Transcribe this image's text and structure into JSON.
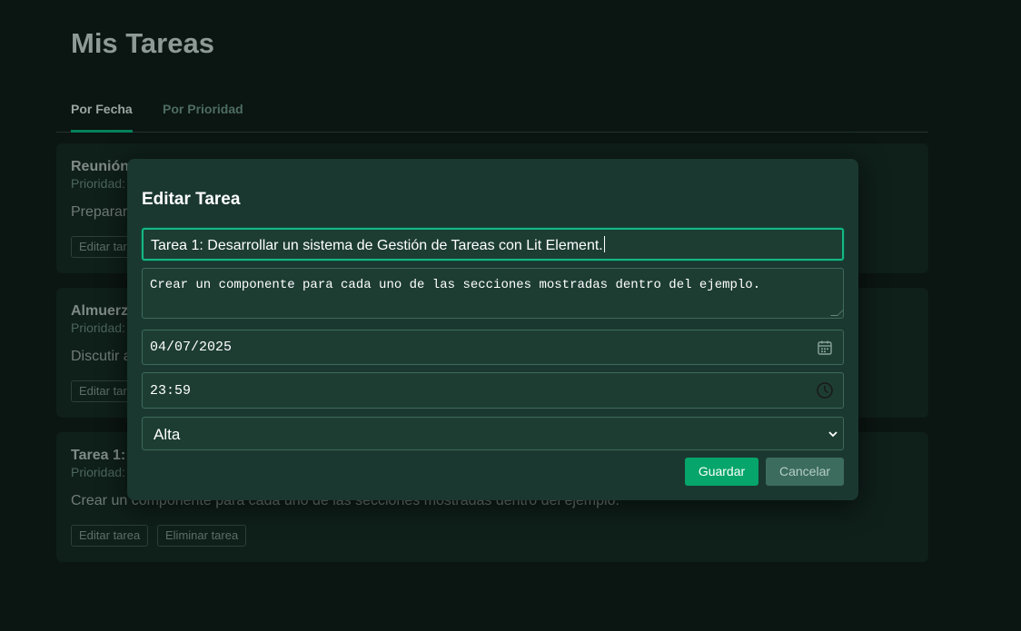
{
  "page": {
    "title": "Mis Tareas",
    "tabs": [
      {
        "label": "Por Fecha",
        "active": true
      },
      {
        "label": "Por Prioridad",
        "active": false
      }
    ]
  },
  "tasks": [
    {
      "title": "Reunión",
      "priority": "Prioridad:",
      "description": "Preparar",
      "edit_label": "Editar tar",
      "delete_label": ""
    },
    {
      "title": "Almuerz",
      "priority": "Prioridad:",
      "description": "Discutir a",
      "edit_label": "Editar tar",
      "delete_label": ""
    },
    {
      "title": "Tarea 1:",
      "priority": "Prioridad:",
      "description": "Crear un componente para cada uno de las secciones mostradas dentro del ejemplo.",
      "edit_label": "Editar tarea",
      "delete_label": "Eliminar tarea"
    }
  ],
  "modal": {
    "title": "Editar Tarea",
    "task_title_value": "Tarea 1: Desarrollar un sistema de Gestión de Tareas con Lit Element.",
    "description_value": "Crear un componente para cada uno de las secciones mostradas dentro del ejemplo.",
    "date_value": "04/07/2025",
    "time_value": "23:59",
    "priority_value": "Alta",
    "save_label": "Guardar",
    "cancel_label": "Cancelar"
  },
  "colors": {
    "background": "#0b1512",
    "modal_bg": "#1b3830",
    "accent": "#06a56b",
    "focus_border": "#14b885"
  },
  "icons": {
    "date": "calendar-icon",
    "time": "clock-icon",
    "select": "chevron-down-icon"
  }
}
